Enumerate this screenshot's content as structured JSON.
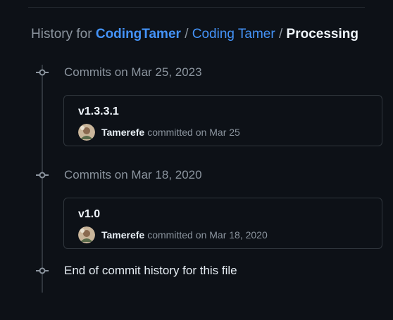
{
  "breadcrumb": {
    "prefix": "History for",
    "owner": "CodingTamer",
    "repo": "Coding Tamer",
    "path": "Processing",
    "separator": "/"
  },
  "groups": [
    {
      "title": "Commits on Mar 25, 2023",
      "commits": [
        {
          "message": "v1.3.3.1",
          "author": "Tamerefe",
          "action": "committed",
          "date": "on Mar 25"
        }
      ]
    },
    {
      "title": "Commits on Mar 18, 2020",
      "commits": [
        {
          "message": "v1.0",
          "author": "Tamerefe",
          "action": "committed",
          "date": "on Mar 18, 2020"
        }
      ]
    }
  ],
  "end_text": "End of commit history for this file",
  "icons": {
    "node": "git-commit-icon",
    "avatar": "avatar"
  },
  "colors": {
    "background": "#0d1117",
    "link": "#4493f8",
    "muted": "#8b949e",
    "border": "#30363d",
    "text": "#e6edf3"
  }
}
